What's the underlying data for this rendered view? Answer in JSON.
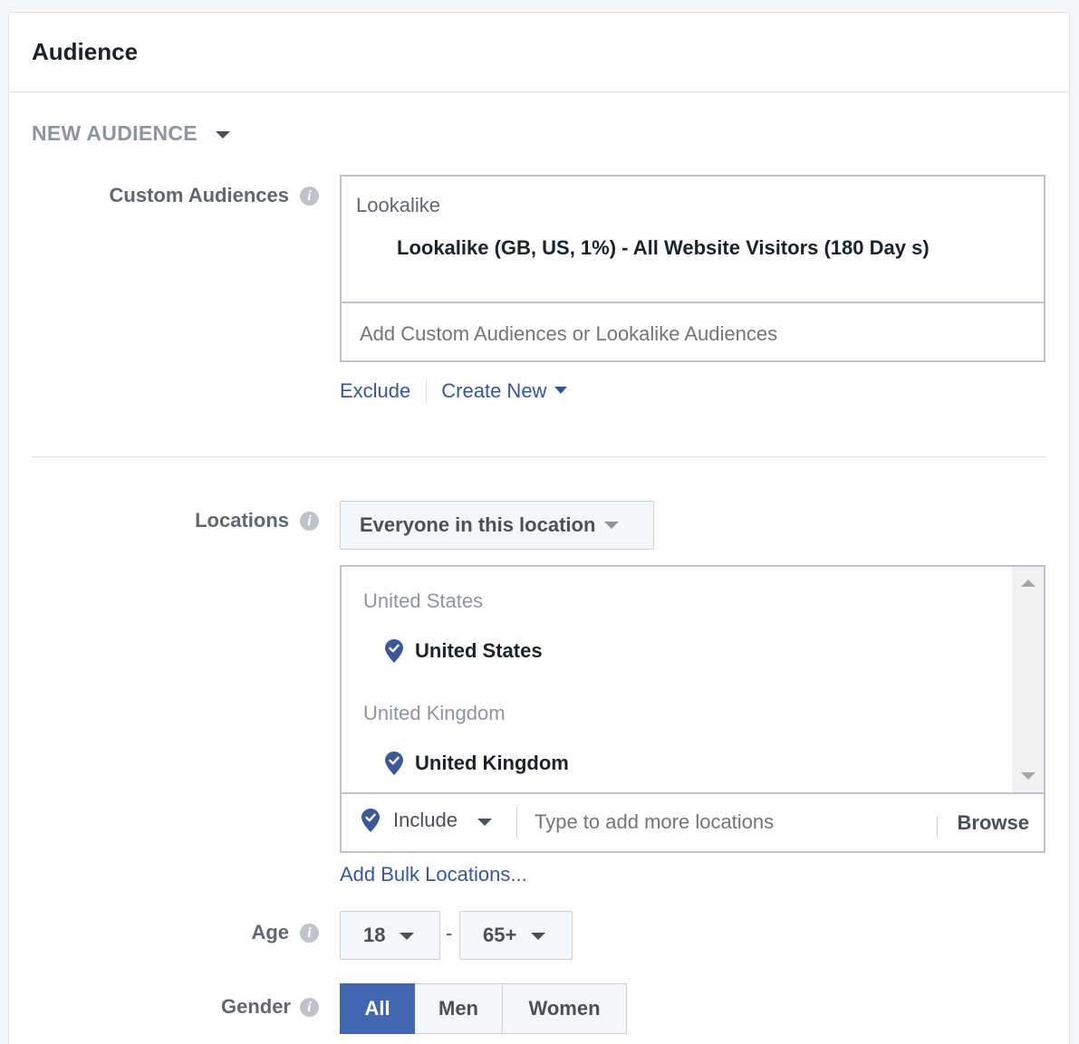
{
  "panel": {
    "title": "Audience"
  },
  "section": {
    "toggle_label": "NEW AUDIENCE"
  },
  "custom_audiences": {
    "label": "Custom Audiences",
    "group_title": "Lookalike",
    "selected_item": "Lookalike (GB, US, 1%) - All Website Visitors (180 Day s)",
    "input_placeholder": "Add Custom Audiences or Lookalike Audiences",
    "exclude_link": "Exclude",
    "create_new_link": "Create New"
  },
  "locations": {
    "label": "Locations",
    "type_selector": "Everyone in this location",
    "groups": [
      {
        "title": "United States",
        "item": "United States"
      },
      {
        "title": "United Kingdom",
        "item": "United Kingdom"
      }
    ],
    "include_label": "Include",
    "input_placeholder": "Type to add more locations",
    "browse_label": "Browse",
    "bulk_link": "Add Bulk Locations..."
  },
  "age": {
    "label": "Age",
    "min": "18",
    "separator": "-",
    "max": "65+"
  },
  "gender": {
    "label": "Gender",
    "options": [
      "All",
      "Men",
      "Women"
    ],
    "selected": "All"
  },
  "colors": {
    "accent": "#4267b2",
    "link": "#365899",
    "pin": "#3b5998"
  }
}
